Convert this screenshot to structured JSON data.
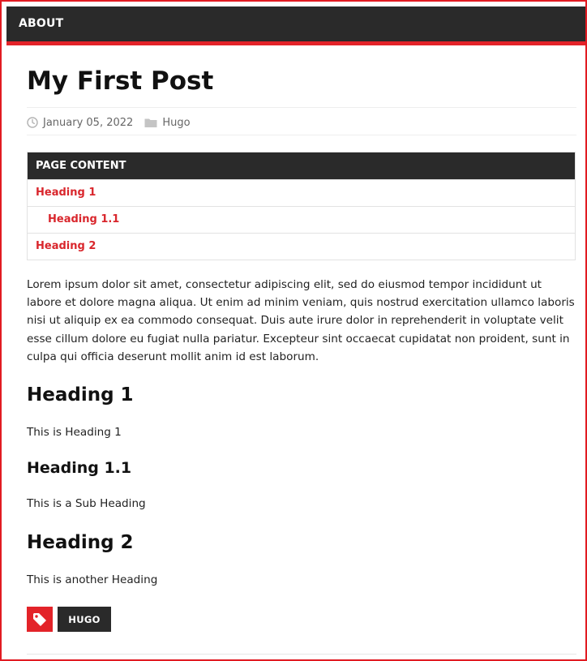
{
  "nav": {
    "about_label": "ABOUT"
  },
  "post": {
    "title": "My First Post",
    "date": "January 05, 2022",
    "category": "Hugo"
  },
  "toc": {
    "header": "PAGE CONTENT",
    "items": [
      {
        "label": "Heading 1",
        "level": 1
      },
      {
        "label": "Heading 1.1",
        "level": 2
      },
      {
        "label": "Heading 2",
        "level": 1
      }
    ]
  },
  "body": {
    "lorem": "Lorem ipsum dolor sit amet, consectetur adipiscing elit, sed do eiusmod tempor incididunt ut labore et dolore magna aliqua. Ut enim ad minim veniam, quis nostrud exercitation ullamco laboris nisi ut aliquip ex ea commodo consequat. Duis aute irure dolor in reprehenderit in voluptate velit esse cillum dolore eu fugiat nulla pariatur. Excepteur sint occaecat cupidatat non proident, sunt in culpa qui officia deserunt mollit anim id est laborum.",
    "sections": [
      {
        "heading": "Heading 1",
        "text": "This is Heading 1"
      },
      {
        "heading": "Heading 1.1",
        "text": "This is a Sub Heading"
      },
      {
        "heading": "Heading 2",
        "text": "This is another Heading"
      }
    ]
  },
  "tags": {
    "icon": "tag-icon",
    "items": [
      "HUGO"
    ]
  },
  "colors": {
    "accent": "#e32329",
    "dark": "#2a2a2a",
    "link": "#d9262c"
  }
}
